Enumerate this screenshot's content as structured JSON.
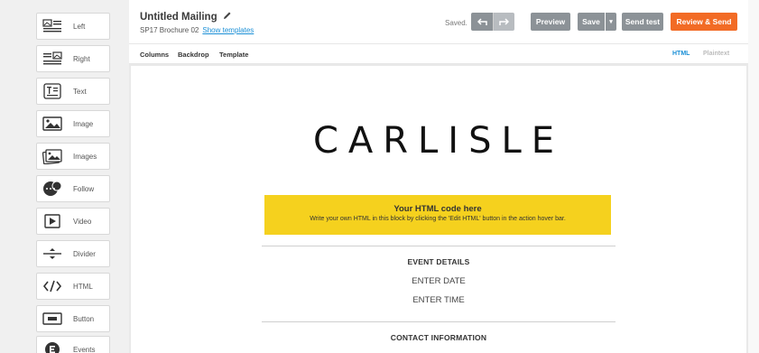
{
  "sidebar": {
    "items": [
      {
        "label": "Left",
        "icon": "image-left-icon"
      },
      {
        "label": "Right",
        "icon": "image-right-icon"
      },
      {
        "label": "Text",
        "icon": "text-icon"
      },
      {
        "label": "Image",
        "icon": "image-icon"
      },
      {
        "label": "Images",
        "icon": "images-icon"
      },
      {
        "label": "Follow",
        "icon": "follow-icon"
      },
      {
        "label": "Video",
        "icon": "video-icon"
      },
      {
        "label": "Divider",
        "icon": "divider-icon"
      },
      {
        "label": "HTML",
        "icon": "html-icon"
      },
      {
        "label": "Button",
        "icon": "button-icon"
      },
      {
        "label": "Events",
        "icon": "events-icon"
      }
    ]
  },
  "header": {
    "title": "Untitled Mailing",
    "subtitle": "SP17 Brochure 02",
    "show_templates": "Show templates",
    "saved": "Saved.",
    "preview": "Preview",
    "save": "Save",
    "save_dropdown": "▾",
    "send_test": "Send test",
    "review_send": "Review & Send"
  },
  "subbar": {
    "columns": "Columns",
    "backdrop": "Backdrop",
    "template": "Template",
    "html": "HTML",
    "plaintext": "Plaintext"
  },
  "canvas": {
    "logo": "CARLISLE",
    "html_block_title": "Your HTML code here",
    "html_block_desc": "Write your own HTML in this block by clicking the 'Edit HTML' button in the action hover bar.",
    "event_details_title": "EVENT DETAILS",
    "enter_date": "ENTER DATE",
    "enter_time": "ENTER TIME",
    "contact_title": "CONTACT INFORMATION"
  },
  "colors": {
    "accent": "#f26b25",
    "button_gray": "#8c9297",
    "html_block": "#f5d11e",
    "link": "#1a8fd6"
  }
}
